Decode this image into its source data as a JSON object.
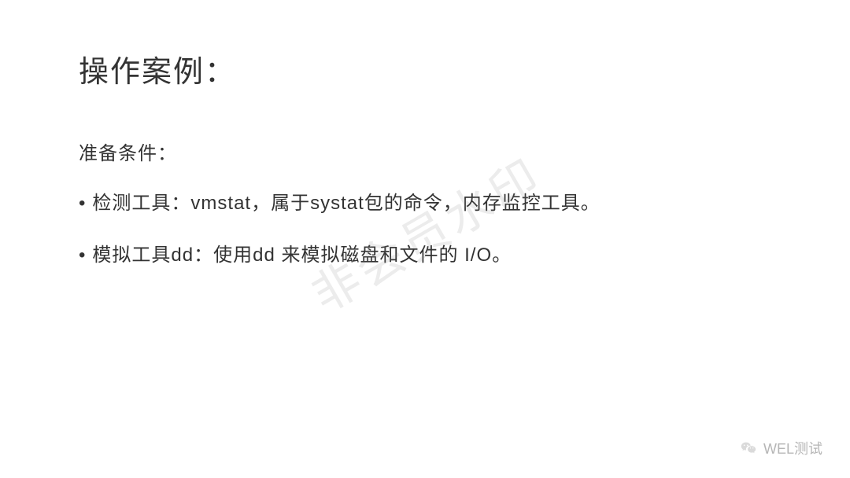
{
  "slide": {
    "title": "操作案例：",
    "subtitle": "准备条件：",
    "bullets": [
      "检测工具：vmstat，属于systat包的命令，内存监控工具。",
      "模拟工具dd：使用dd 来模拟磁盘和文件的 I/O。"
    ]
  },
  "watermark": "非会员水印",
  "attribution": {
    "label": "WEL测试"
  }
}
